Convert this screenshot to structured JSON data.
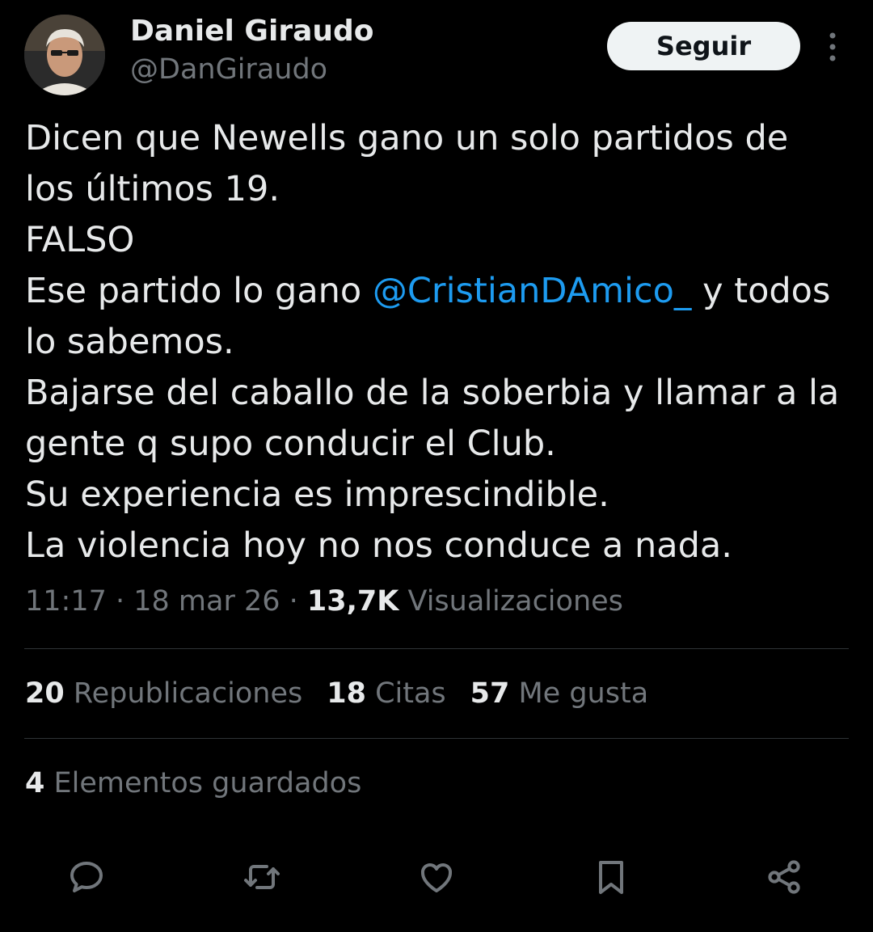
{
  "author": {
    "name": "Daniel Giraudo",
    "handle": "@DanGiraudo",
    "avatar_icon": "profile-photo"
  },
  "follow_label": "Seguir",
  "more_icon": "more-vertical-icon",
  "tweet": {
    "l1": "Dicen que Newells gano un solo partidos de",
    "l2": "los últimos 19.",
    "l3": "FALSO",
    "l4_pre": "Ese partido lo gano ",
    "l4_mention": "@CristianDAmico_",
    "l4_post": " y todos",
    "l5": "lo sabemos.",
    "l6": "Bajarse del caballo de la soberbia y llamar a la",
    "l7": "gente q supo conducir el Club.",
    "l8": "Su experiencia es imprescindible.",
    "l9": "La violencia hoy no nos conduce a nada."
  },
  "meta": {
    "time": "11:17",
    "sep1": " · ",
    "date": "18 mar 26",
    "sep2": " · ",
    "views_count": "13,7K",
    "views_label": " Visualizaciones"
  },
  "stats": {
    "reposts_count": "20",
    "reposts_label": " Republicaciones",
    "quotes_count": "18",
    "quotes_label": " Citas",
    "likes_count": "57",
    "likes_label": " Me gusta"
  },
  "saved": {
    "count": "4",
    "label": " Elementos guardados"
  },
  "colors": {
    "background": "#000000",
    "text": "#e7e9ea",
    "secondary": "#71767b",
    "mention": "#1d9bf0",
    "divider": "#2f3336"
  },
  "actions": [
    "reply-icon",
    "repost-icon",
    "like-icon",
    "bookmark-icon",
    "share-icon"
  ]
}
